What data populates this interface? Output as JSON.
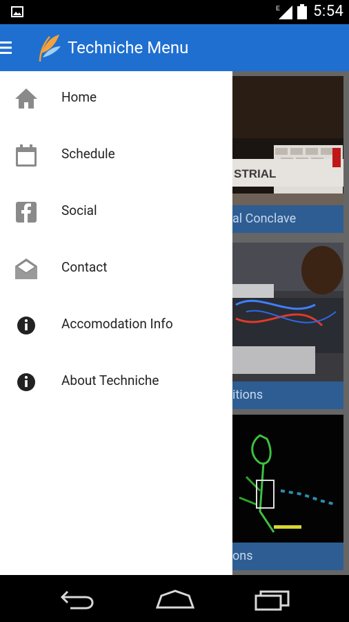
{
  "status_bar": {
    "time": "5:54",
    "network_label": "E",
    "icons": [
      "image-icon",
      "signal-icon",
      "battery-icon"
    ]
  },
  "app_bar": {
    "title": "Techniche Menu",
    "icons": [
      "hamburger-menu-icon",
      "techniche-logo"
    ]
  },
  "drawer": {
    "items": [
      {
        "label": "Home",
        "icon": "home-icon"
      },
      {
        "label": "Schedule",
        "icon": "calendar-icon"
      },
      {
        "label": "Social",
        "icon": "facebook-icon"
      },
      {
        "label": "Contact",
        "icon": "envelope-open-icon"
      },
      {
        "label": "Accomodation Info",
        "icon": "info-icon"
      },
      {
        "label": "About Techniche",
        "icon": "info-icon"
      }
    ]
  },
  "background_cards": [
    {
      "caption": "al Conclave",
      "sign_text": "STRIAL"
    },
    {
      "caption": "itions"
    },
    {
      "caption": "ons"
    }
  ],
  "nav_bar": {
    "icons": [
      "back-icon",
      "home-nav-icon",
      "recents-icon"
    ]
  },
  "colors": {
    "app_bar": "#1f6fd1",
    "drawer_bg": "#ffffff",
    "icon_gray": "#8a8a8a",
    "caption_bg": "#2d5d92"
  }
}
